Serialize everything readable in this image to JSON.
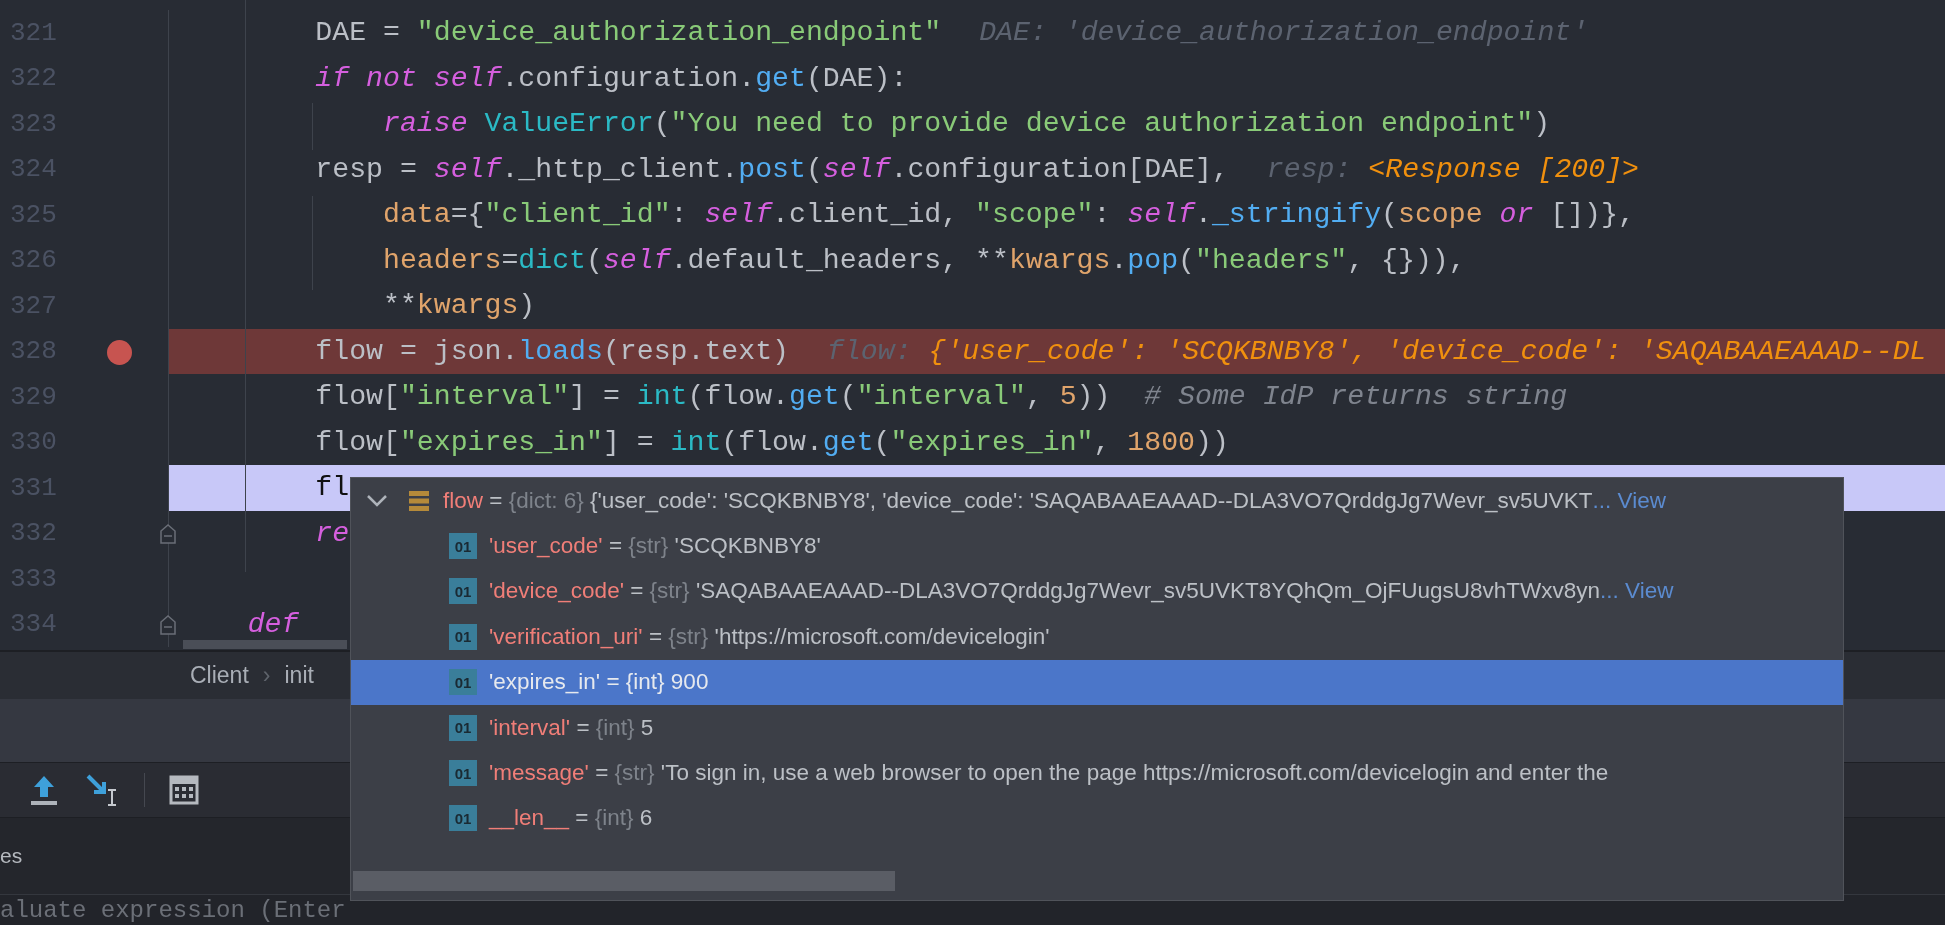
{
  "editor": {
    "lines": [
      {
        "number": "321",
        "breakpoint": false,
        "current": false,
        "fold_marker": false,
        "tokens": [
          {
            "kind": "plain",
            "t": "        DAE = "
          },
          {
            "kind": "str",
            "t": "\"device_authorization_endpoint\""
          }
        ],
        "hint": [
          {
            "kind": "label",
            "t": "DAE: 'device_authorization_endpoint'"
          }
        ]
      },
      {
        "number": "322",
        "breakpoint": false,
        "current": false,
        "fold_marker": false,
        "tokens": [
          {
            "kind": "kw",
            "t": "        if not self"
          },
          {
            "kind": "plain",
            "t": ".configuration."
          },
          {
            "kind": "fn",
            "t": "get"
          },
          {
            "kind": "plain",
            "t": "(DAE):"
          }
        ]
      },
      {
        "number": "323",
        "breakpoint": false,
        "current": false,
        "fold_marker": false,
        "tokens": [
          {
            "kind": "kw",
            "t": "            raise"
          },
          {
            "kind": "cls",
            "t": " ValueError"
          },
          {
            "kind": "plain",
            "t": "("
          },
          {
            "kind": "str",
            "t": "\"You need to provide device authorization endpoint\""
          },
          {
            "kind": "plain",
            "t": ")"
          }
        ]
      },
      {
        "number": "324",
        "breakpoint": false,
        "current": false,
        "fold_marker": false,
        "tokens": [
          {
            "kind": "plain",
            "t": "        resp = "
          },
          {
            "kind": "kw",
            "t": "self"
          },
          {
            "kind": "plain",
            "t": "._http_client."
          },
          {
            "kind": "fn",
            "t": "post"
          },
          {
            "kind": "plain",
            "t": "("
          },
          {
            "kind": "kw",
            "t": "self"
          },
          {
            "kind": "plain",
            "t": ".configuration[DAE],"
          }
        ],
        "hint": [
          {
            "kind": "label",
            "t": "resp: "
          },
          {
            "kind": "value",
            "t": "<Response [200]>"
          }
        ]
      },
      {
        "number": "325",
        "breakpoint": false,
        "current": false,
        "fold_marker": false,
        "tokens": [
          {
            "kind": "param",
            "t": "            data"
          },
          {
            "kind": "plain",
            "t": "={"
          },
          {
            "kind": "str",
            "t": "\"client_id\""
          },
          {
            "kind": "plain",
            "t": ": "
          },
          {
            "kind": "kw",
            "t": "self"
          },
          {
            "kind": "plain",
            "t": ".client_id, "
          },
          {
            "kind": "str",
            "t": "\"scope\""
          },
          {
            "kind": "plain",
            "t": ": "
          },
          {
            "kind": "kw",
            "t": "self"
          },
          {
            "kind": "plain",
            "t": "."
          },
          {
            "kind": "fn",
            "t": "_stringify"
          },
          {
            "kind": "plain",
            "t": "("
          },
          {
            "kind": "param",
            "t": "scope"
          },
          {
            "kind": "kw",
            "t": " or"
          },
          {
            "kind": "plain",
            "t": " [])},"
          }
        ]
      },
      {
        "number": "326",
        "breakpoint": false,
        "current": false,
        "fold_marker": false,
        "tokens": [
          {
            "kind": "param",
            "t": "            headers"
          },
          {
            "kind": "plain",
            "t": "="
          },
          {
            "kind": "cls",
            "t": "dict"
          },
          {
            "kind": "plain",
            "t": "("
          },
          {
            "kind": "kw",
            "t": "self"
          },
          {
            "kind": "plain",
            "t": ".default_headers, **"
          },
          {
            "kind": "param",
            "t": "kwargs"
          },
          {
            "kind": "plain",
            "t": "."
          },
          {
            "kind": "fn",
            "t": "pop"
          },
          {
            "kind": "plain",
            "t": "("
          },
          {
            "kind": "str",
            "t": "\"headers\""
          },
          {
            "kind": "plain",
            "t": ", {})),"
          }
        ]
      },
      {
        "number": "327",
        "breakpoint": false,
        "current": false,
        "fold_marker": false,
        "tokens": [
          {
            "kind": "plain",
            "t": "            **"
          },
          {
            "kind": "param",
            "t": "kwargs"
          },
          {
            "kind": "plain",
            "t": ")"
          }
        ]
      },
      {
        "number": "328",
        "breakpoint": true,
        "current": false,
        "fold_marker": false,
        "tokens": [
          {
            "kind": "plain",
            "t": "        flow = json."
          },
          {
            "kind": "fn",
            "t": "loads"
          },
          {
            "kind": "plain",
            "t": "(resp.text)"
          }
        ],
        "hint": [
          {
            "kind": "label",
            "t": "flow: "
          },
          {
            "kind": "value",
            "t": "{'user_code': 'SCQKBNBY8', 'device_code': 'SAQABAAEAAAD--DL"
          }
        ]
      },
      {
        "number": "329",
        "breakpoint": false,
        "current": false,
        "fold_marker": false,
        "tokens": [
          {
            "kind": "plain",
            "t": "        flow["
          },
          {
            "kind": "str",
            "t": "\"interval\""
          },
          {
            "kind": "plain",
            "t": "] = "
          },
          {
            "kind": "cls",
            "t": "int"
          },
          {
            "kind": "plain",
            "t": "(flow."
          },
          {
            "kind": "fn",
            "t": "get"
          },
          {
            "kind": "plain",
            "t": "("
          },
          {
            "kind": "str",
            "t": "\"interval\""
          },
          {
            "kind": "plain",
            "t": ", "
          },
          {
            "kind": "num",
            "t": "5"
          },
          {
            "kind": "plain",
            "t": "))"
          },
          {
            "kind": "comment",
            "t": "  # Some IdP returns string"
          }
        ]
      },
      {
        "number": "330",
        "breakpoint": false,
        "current": false,
        "fold_marker": false,
        "tokens": [
          {
            "kind": "plain",
            "t": "        flow["
          },
          {
            "kind": "str",
            "t": "\"expires_in\""
          },
          {
            "kind": "plain",
            "t": "] = "
          },
          {
            "kind": "cls",
            "t": "int"
          },
          {
            "kind": "plain",
            "t": "(flow."
          },
          {
            "kind": "fn",
            "t": "get"
          },
          {
            "kind": "plain",
            "t": "("
          },
          {
            "kind": "str",
            "t": "\"expires_in\""
          },
          {
            "kind": "plain",
            "t": ", "
          },
          {
            "kind": "num",
            "t": "1800"
          },
          {
            "kind": "plain",
            "t": "))"
          }
        ]
      },
      {
        "number": "331",
        "breakpoint": false,
        "current": true,
        "fold_marker": false,
        "tokens": [
          {
            "kind": "plain",
            "t": "        fl"
          }
        ]
      },
      {
        "number": "332",
        "breakpoint": false,
        "current": false,
        "fold_marker": true,
        "tokens": [
          {
            "kind": "kw",
            "t": "        re"
          }
        ]
      },
      {
        "number": "333",
        "breakpoint": false,
        "current": false,
        "fold_marker": false
      },
      {
        "number": "334",
        "breakpoint": false,
        "current": false,
        "fold_marker": true,
        "tokens": [
          {
            "kind": "kw",
            "t": "    def"
          }
        ]
      }
    ]
  },
  "breadcrumb": {
    "items": [
      "Client",
      "init"
    ],
    "separator": "›"
  },
  "panel_tab": "es",
  "evaluate_field": {
    "placeholder": "aluate expression (Enter"
  },
  "debug_popup": {
    "root": {
      "name": "flow",
      "op": "=",
      "type": "{dict: 6}",
      "value": "{'user_code': 'SCQKBNBY8', 'device_code': 'SAQABAAEAAAD--DLA3VO7QrddgJg7Wevr_sv5UVKT",
      "link": "... View",
      "expanded": true
    },
    "children": [
      {
        "badge": "01",
        "name": "'user_code'",
        "op": "=",
        "type": "{str}",
        "value": "'SCQKBNBY8'",
        "selected": false
      },
      {
        "badge": "01",
        "name": "'device_code'",
        "op": "=",
        "type": "{str}",
        "value": "'SAQABAAEAAAD--DLA3VO7QrddgJg7Wevr_sv5UVKT8YQhQm_OjFUugsU8vhTWxv8yn",
        "link": "... View",
        "selected": false
      },
      {
        "badge": "01",
        "name": "'verification_uri'",
        "op": "=",
        "type": "{str}",
        "value": "'https://microsoft.com/devicelogin'",
        "selected": false
      },
      {
        "badge": "01",
        "name": "'expires_in'",
        "op": "=",
        "type": "{int}",
        "value": "900",
        "selected": true
      },
      {
        "badge": "01",
        "name": "'interval'",
        "op": "=",
        "type": "{int}",
        "value": "5",
        "selected": false
      },
      {
        "badge": "01",
        "name": "'message'",
        "op": "=",
        "type": "{str}",
        "value": "'To sign in, use a web browser to open the page https://microsoft.com/devicelogin and enter the",
        "selected": false
      },
      {
        "badge": "01",
        "name": "__len__",
        "op": "=",
        "type": "{int}",
        "value": "6",
        "selected": false
      }
    ]
  }
}
